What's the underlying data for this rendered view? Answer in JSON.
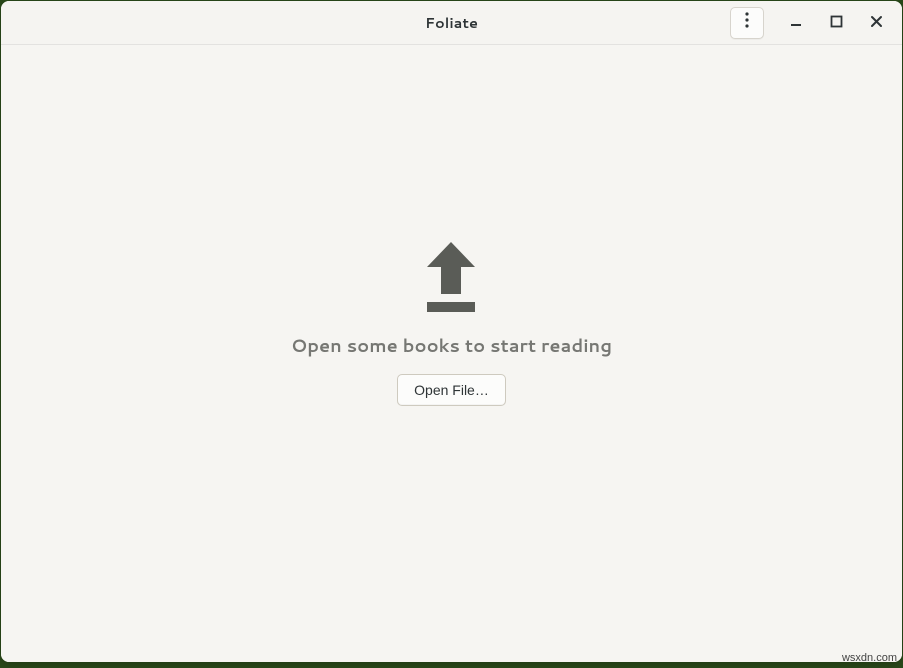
{
  "header": {
    "title": "Foliate"
  },
  "main": {
    "empty_state_text": "Open some books to start reading",
    "open_button_label": "Open File…"
  },
  "watermark": "wsxdn.com"
}
